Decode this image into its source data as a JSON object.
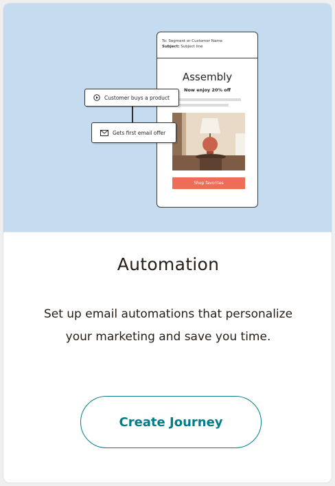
{
  "illustration": {
    "to_line": "To: Segment or Customer Name",
    "subject_label": "Subject:",
    "subject_value": "Subject line",
    "brand": "Assembly",
    "promo": "Now enjoy 20% off",
    "shop_button": "Shop favorites",
    "step_1": "Customer buys a product",
    "step_2": "Gets first email offer"
  },
  "card": {
    "title": "Automation",
    "description": "Set up email automations that personalize your marketing and save you time.",
    "cta_label": "Create Journey"
  },
  "colors": {
    "hero_background": "#c5dbf0",
    "accent": "#007c89",
    "shop_button": "#ee6d57"
  },
  "icons": [
    "play-circle-icon",
    "envelope-icon"
  ]
}
